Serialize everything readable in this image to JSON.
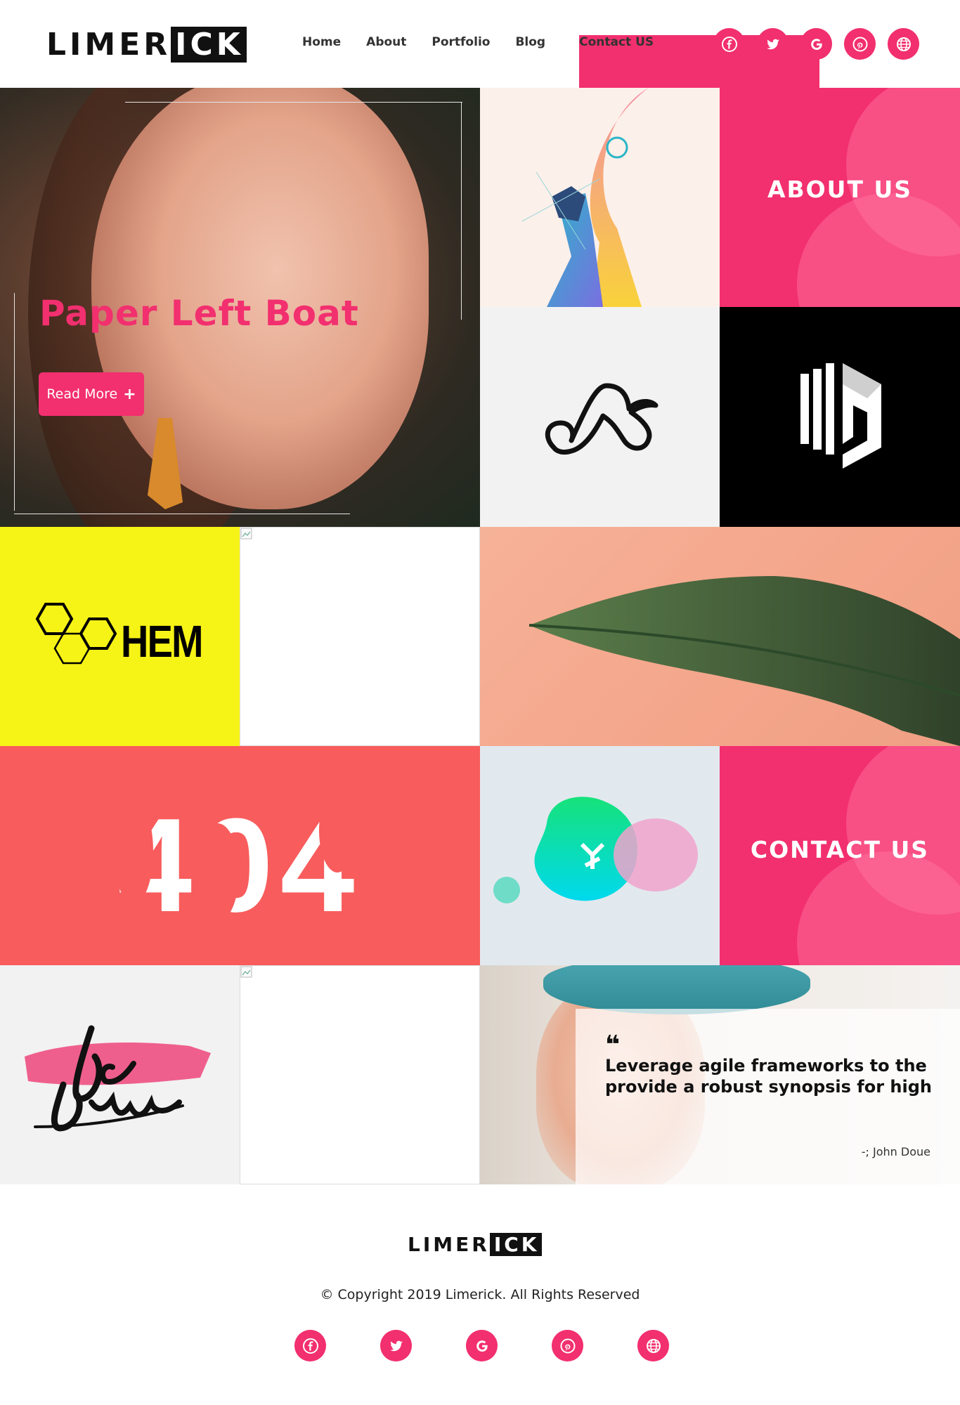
{
  "header": {
    "logo": {
      "part1": "LIMER",
      "part2": "ICK"
    },
    "nav": [
      "Home",
      "About",
      "Portfolio",
      "Blog",
      "Contact US"
    ],
    "socials": [
      "facebook-icon",
      "twitter-icon",
      "google-icon",
      "pinterest-icon",
      "globe-icon"
    ]
  },
  "hero": {
    "title": "Paper Left Boat",
    "button_label": "Read More",
    "button_icon": "+"
  },
  "tiles": {
    "about_label": "ABOUT US",
    "chem_word": "HEM",
    "error_code": "404",
    "contact_label": "CONTACT US"
  },
  "quote": {
    "mark": "❝",
    "text": "Leverage agile frameworks to the provide a robust synopsis for high",
    "author": "-; John Doue"
  },
  "footer": {
    "logo": {
      "part1": "LIMER",
      "part2": "ICK"
    },
    "copyright": "© Copyright 2019 Limerick. All Rights Reserved",
    "socials": [
      "facebook-icon",
      "twitter-icon",
      "google-icon",
      "pinterest-icon",
      "globe-icon"
    ]
  },
  "colors": {
    "accent": "#f22f6f",
    "error_bg": "#f85c5c",
    "chem_bg": "#f6f316",
    "dark": "#000000"
  }
}
